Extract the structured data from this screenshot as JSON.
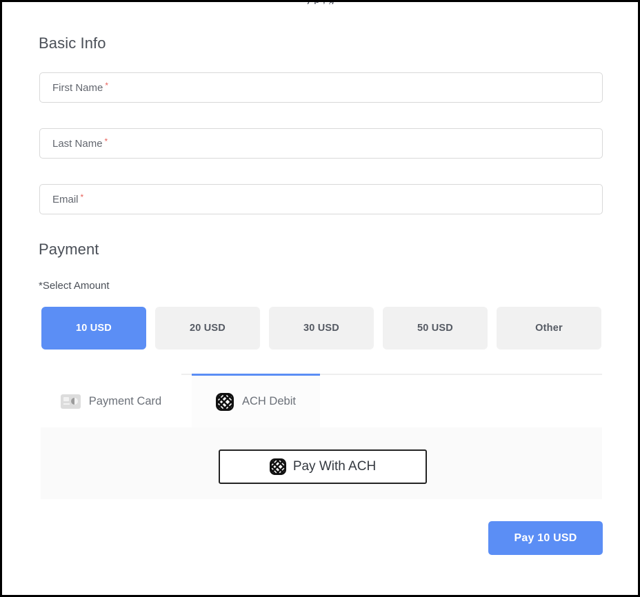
{
  "window": {
    "clipped_top_text": "y   p      ,       g"
  },
  "basic_info": {
    "heading": "Basic Info",
    "fields": [
      {
        "name": "first-name",
        "placeholder": "First Name",
        "value": "",
        "required_mark": "*"
      },
      {
        "name": "last-name",
        "placeholder": "Last Name",
        "value": "",
        "required_mark": "*"
      },
      {
        "name": "email",
        "placeholder": "Email",
        "value": "",
        "required_mark": "*"
      }
    ]
  },
  "payment": {
    "heading": "Payment",
    "select_amount_label": "*Select Amount",
    "amounts": [
      {
        "label": "10 USD",
        "selected": true
      },
      {
        "label": "20 USD",
        "selected": false
      },
      {
        "label": "30 USD",
        "selected": false
      },
      {
        "label": "50 USD",
        "selected": false
      },
      {
        "label": "Other",
        "selected": false
      }
    ],
    "tabs": [
      {
        "label": "Payment Card",
        "icon": "payment-card-icon",
        "active": false
      },
      {
        "label": "ACH Debit",
        "icon": "ach-lattice-icon",
        "active": true
      }
    ],
    "panel": {
      "pay_with_ach_label": "Pay With ACH",
      "pay_with_ach_icon": "ach-lattice-icon"
    },
    "submit_label": "Pay 10 USD"
  },
  "colors": {
    "accent_blue": "#5b8ef5",
    "required_red": "#e8615a",
    "amount_idle_bg": "#f1f1f1",
    "panel_bg": "#fafafa",
    "frame_border": "#000000"
  }
}
